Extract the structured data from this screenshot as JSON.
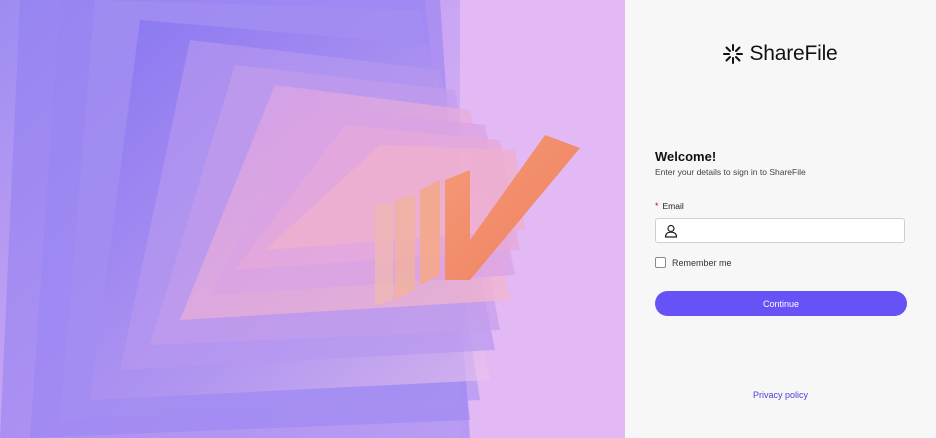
{
  "brand": {
    "name": "ShareFile",
    "logo_icon": "sharefile-starburst-icon"
  },
  "hero": {
    "image_icon": "abstract-layered-panels-artwork",
    "background_color": "#e2b9f4"
  },
  "login": {
    "heading": "Welcome!",
    "subtitle": "Enter your details to sign in to ShareFile",
    "email": {
      "label": "Email",
      "required_marker": "*",
      "value": "",
      "placeholder": "",
      "icon": "user-icon"
    },
    "remember_me": {
      "label": "Remember me",
      "checked": false
    },
    "continue_label": "Continue",
    "accent_color": "#6652f5"
  },
  "footer": {
    "privacy_label": "Privacy policy"
  }
}
